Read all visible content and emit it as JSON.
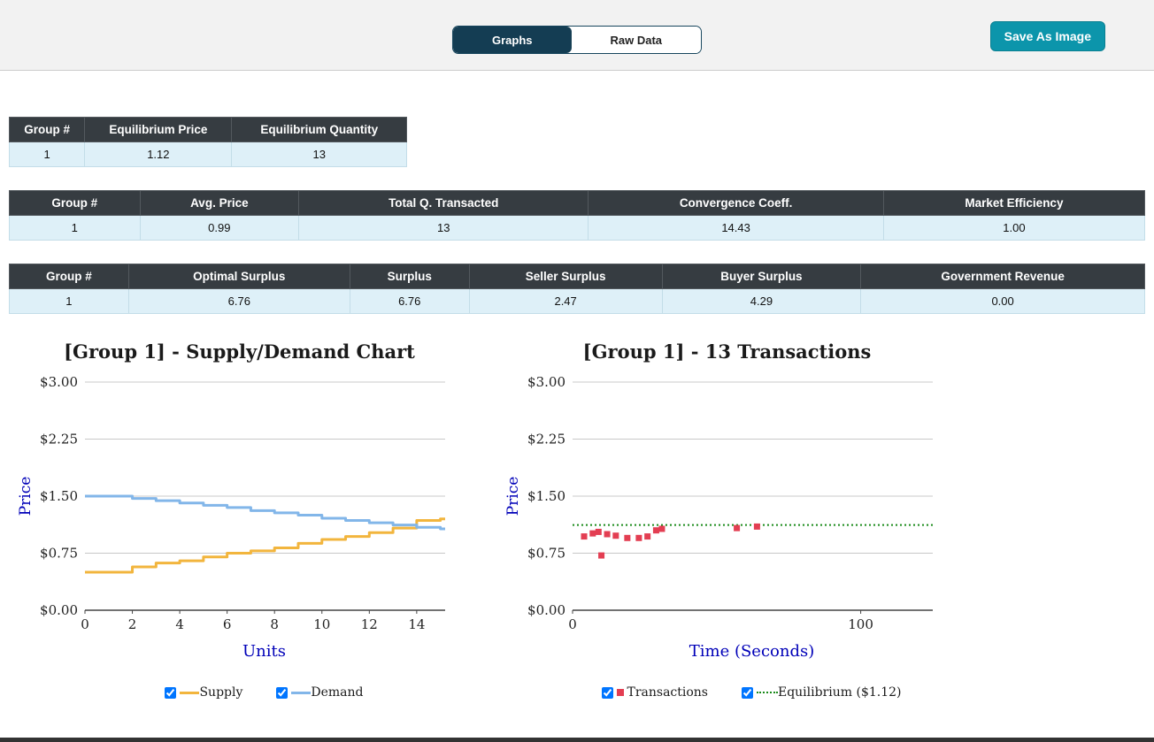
{
  "toolbar": {
    "tabs": [
      {
        "label": "Graphs",
        "active": true
      },
      {
        "label": "Raw Data",
        "active": false
      }
    ],
    "save_button": "Save As Image"
  },
  "tables": {
    "equilibrium": {
      "headers": [
        "Group #",
        "Equilibrium Price",
        "Equilibrium Quantity"
      ],
      "rows": [
        [
          "1",
          "1.12",
          "13"
        ]
      ]
    },
    "market": {
      "headers": [
        "Group #",
        "Avg. Price",
        "Total Q. Transacted",
        "Convergence Coeff.",
        "Market Efficiency"
      ],
      "rows": [
        [
          "1",
          "0.99",
          "13",
          "14.43",
          "1.00"
        ]
      ]
    },
    "surplus": {
      "headers": [
        "Group #",
        "Optimal Surplus",
        "Surplus",
        "Seller Surplus",
        "Buyer Surplus",
        "Government Revenue"
      ],
      "rows": [
        [
          "1",
          "6.76",
          "6.76",
          "2.47",
          "4.29",
          "0.00"
        ]
      ]
    }
  },
  "colors": {
    "supply": "#f2b53d",
    "demand": "#82b6e9",
    "transactions": "#e33e52",
    "equilibrium": "#1a8a1a",
    "tab_active_bg": "#143d53",
    "save_button_bg": "#0c95ab",
    "table_header_bg": "#363c41",
    "table_row_bg": "#def0f8",
    "axis_label": "#0000b8"
  },
  "chart_data": [
    {
      "type": "line",
      "title": "[Group 1] - Supply/Demand Chart",
      "xlabel": "Units",
      "ylabel": "Price",
      "xlim": [
        0,
        15.2
      ],
      "ylim": [
        0,
        3
      ],
      "xticks": [
        0,
        2,
        4,
        6,
        8,
        10,
        12,
        14
      ],
      "yticks": [
        0,
        0.75,
        1.5,
        2.25,
        3
      ],
      "ytick_labels": [
        "$0.00",
        "$0.75",
        "$1.50",
        "$2.25",
        "$3.00"
      ],
      "grid": true,
      "legend_position": "bottom",
      "series": [
        {
          "name": "Supply",
          "color": "#f2b53d",
          "step": true,
          "x": [
            0,
            1,
            2,
            3,
            4,
            5,
            6,
            7,
            8,
            9,
            10,
            11,
            12,
            13,
            14,
            15
          ],
          "values": [
            0.5,
            0.5,
            0.57,
            0.62,
            0.65,
            0.7,
            0.75,
            0.78,
            0.82,
            0.88,
            0.93,
            0.97,
            1.02,
            1.08,
            1.18,
            1.2
          ]
        },
        {
          "name": "Demand",
          "color": "#82b6e9",
          "step": true,
          "x": [
            0,
            1,
            2,
            3,
            4,
            5,
            6,
            7,
            8,
            9,
            10,
            11,
            12,
            13,
            14,
            15
          ],
          "values": [
            1.5,
            1.5,
            1.47,
            1.44,
            1.41,
            1.38,
            1.35,
            1.31,
            1.28,
            1.25,
            1.21,
            1.18,
            1.15,
            1.12,
            1.09,
            1.07
          ]
        }
      ],
      "legend": [
        {
          "label": "Supply",
          "checked": true
        },
        {
          "label": "Demand",
          "checked": true
        }
      ]
    },
    {
      "type": "scatter",
      "title": "[Group 1] - 13 Transactions",
      "xlabel": "Time (Seconds)",
      "ylabel": "Price",
      "xlim": [
        0,
        125
      ],
      "ylim": [
        0,
        3
      ],
      "xticks": [
        0,
        100
      ],
      "yticks": [
        0,
        0.75,
        1.5,
        2.25,
        3
      ],
      "ytick_labels": [
        "$0.00",
        "$0.75",
        "$1.50",
        "$2.25",
        "$3.00"
      ],
      "grid": true,
      "marker_color": "#e33e52",
      "points": [
        [
          4,
          0.97
        ],
        [
          7,
          1.01
        ],
        [
          9,
          1.03
        ],
        [
          10,
          0.72
        ],
        [
          12,
          1.0
        ],
        [
          15,
          0.98
        ],
        [
          19,
          0.95
        ],
        [
          23,
          0.95
        ],
        [
          26,
          0.97
        ],
        [
          29,
          1.05
        ],
        [
          31,
          1.07
        ],
        [
          57,
          1.08
        ],
        [
          64,
          1.1
        ]
      ],
      "equilibrium_value": 1.12,
      "equilibrium_color": "#1a8a1a",
      "legend": [
        {
          "label": "Transactions",
          "checked": true
        },
        {
          "label": "Equilibrium ($1.12)",
          "checked": true
        }
      ]
    }
  ]
}
